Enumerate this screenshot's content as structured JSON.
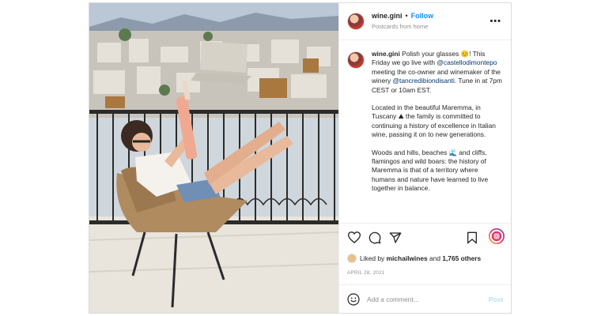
{
  "post": {
    "username": "wine.gini",
    "follow_label": "Follow",
    "location": "Postcards from home",
    "more_label": "•••",
    "caption": {
      "username": "wine.gini",
      "p1_a": "Polish your glasses ",
      "p1_emoji": "😊",
      "p1_b": "! This Friday we go live with ",
      "p1_mention1": "@castellodimontepo",
      "p1_c": " meeting the co-owner and winemaker of the winery ",
      "p1_mention2": "@tancredibiondisanti",
      "p1_d": ". Tune in at 7pm CEST or 10am EST.",
      "p2_a": "Located in the beautiful Maremma, in Tuscany ",
      "p2_emoji": "⛰",
      "p2_b": " the family is committed to continuing a history of excellence in Italian wine, passing it on to new generations.",
      "p3_a": "Woods and hills, beaches ",
      "p3_emoji": "🌊",
      "p3_b": " and cliffs, flamingos and wild boars: the history of Maremma is that of a territory where humans and nature have learned to live together in balance."
    },
    "likes": {
      "prefix": "Liked by ",
      "user": "michailwines",
      "middle": " and ",
      "count": "1,765 others"
    },
    "date": "APRIL 28, 2021",
    "comment": {
      "placeholder": "Add a comment...",
      "post_label": "Post"
    },
    "icons": {
      "like": "heart-icon",
      "comment": "comment-icon",
      "share": "share-icon",
      "save": "bookmark-icon",
      "emoji": "smiley-icon",
      "profile": "instagram-logo-icon"
    },
    "colors": {
      "accent": "#0095f6",
      "mention": "#00376b",
      "muted": "#8e8e8e",
      "post_disabled": "#b2dffc"
    }
  }
}
